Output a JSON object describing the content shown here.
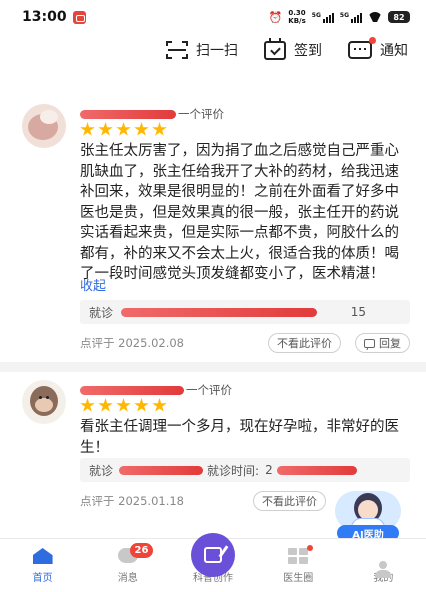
{
  "status_bar": {
    "time": "13:00",
    "net_speed_value": "0.30",
    "net_speed_unit": "KB/s",
    "signal_1": "5G",
    "signal_2": "5G",
    "battery": "82"
  },
  "actions": {
    "scan_label": "扫一扫",
    "checkin_label": "签到",
    "notify_label": "通知"
  },
  "reviews": [
    {
      "count_suffix": "一个评价",
      "rating_stars": 5,
      "text": "张主任太厉害了，因为捐了血之后感觉自己严重心肌缺血了，张主任给我开了大补的药材，给我迅速补回来，效果是很明显的！之前在外面看了好多中医也是贵，但是效果真的很一般，张主任开的药说实话看起来贵，但是实际一点都不贵，阿胶什么的都有，补的来又不会太上火，很适合我的体质！喝了一段时间感觉头顶发缝都变小了，医术精湛！",
      "collapse_label": "收起",
      "visit_prefix": "就诊",
      "visit_suffix": "15",
      "date": "点评于 2025.02.08",
      "hide_label": "不看此评价",
      "reply_label": "回复"
    },
    {
      "count_suffix": "一个评价",
      "rating_stars": 5,
      "text": "看张主任调理一个多月，现在好孕啦，非常好的医生！",
      "visit_prefix": "就诊",
      "visit_time_label": "就诊时间:",
      "visit_time_value": "2",
      "date": "点评于 2025.01.18",
      "hide_label": "不看此评价"
    }
  ],
  "ai_doctor": {
    "label": "AI医助"
  },
  "nav": {
    "home": "首页",
    "messages": "消息",
    "messages_badge": "26",
    "create": "科普创作",
    "circle": "医生圈",
    "mine": "我的"
  },
  "colors": {
    "accent": "#2f6cdf",
    "star": "#ffb703",
    "badge": "#f04438",
    "create_button": "#6a4fd8"
  }
}
